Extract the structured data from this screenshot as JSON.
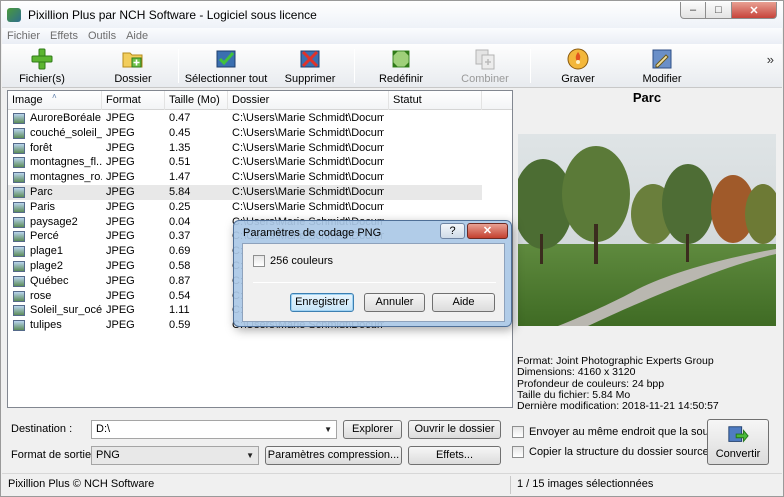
{
  "window": {
    "title": "Pixillion Plus par NCH Software - Logiciel sous licence",
    "minimize": "–",
    "maximize": "□",
    "close": "✕"
  },
  "menu": [
    "Fichier",
    "Effets",
    "Outils",
    "Aide"
  ],
  "toolbar": {
    "add_files": "Fichier(s)",
    "add_folder": "Dossier",
    "select_all": "Sélectionner tout",
    "remove": "Supprimer",
    "resize": "Redéfinir",
    "combine": "Combiner",
    "burn": "Graver",
    "edit": "Modifier",
    "more": "»"
  },
  "file_list": {
    "columns": [
      "Image",
      "Format",
      "Taille (Mo)",
      "Dossier",
      "Statut"
    ],
    "sort_indicator": "˄",
    "rows": [
      {
        "name": "AuroreBoréale",
        "format": "JPEG",
        "size": "0.47",
        "folder": "C:\\Users\\Marie Schmidt\\Docume...",
        "status": ""
      },
      {
        "name": "couché_soleil_...",
        "format": "JPEG",
        "size": "0.45",
        "folder": "C:\\Users\\Marie Schmidt\\Docume...",
        "status": ""
      },
      {
        "name": "forêt",
        "format": "JPEG",
        "size": "1.35",
        "folder": "C:\\Users\\Marie Schmidt\\Docume...",
        "status": ""
      },
      {
        "name": "montagnes_fl...",
        "format": "JPEG",
        "size": "0.51",
        "folder": "C:\\Users\\Marie Schmidt\\Docume...",
        "status": ""
      },
      {
        "name": "montagnes_ro...",
        "format": "JPEG",
        "size": "1.47",
        "folder": "C:\\Users\\Marie Schmidt\\Docume...",
        "status": ""
      },
      {
        "name": "Parc",
        "format": "JPEG",
        "size": "5.84",
        "folder": "C:\\Users\\Marie Schmidt\\Docume...",
        "status": ""
      },
      {
        "name": "Paris",
        "format": "JPEG",
        "size": "0.25",
        "folder": "C:\\Users\\Marie Schmidt\\Docume...",
        "status": ""
      },
      {
        "name": "paysage2",
        "format": "JPEG",
        "size": "0.04",
        "folder": "C:\\Users\\Marie Schmidt\\Docume...",
        "status": ""
      },
      {
        "name": "Percé",
        "format": "JPEG",
        "size": "0.37",
        "folder": "C:\\Users\\Marie Schmidt\\Docume...",
        "status": ""
      },
      {
        "name": "plage1",
        "format": "JPEG",
        "size": "0.69",
        "folder": "C:\\Users\\Marie Schmidt\\Docume...",
        "status": ""
      },
      {
        "name": "plage2",
        "format": "JPEG",
        "size": "0.58",
        "folder": "C:\\Users\\Marie Schmidt\\Docume...",
        "status": ""
      },
      {
        "name": "Québec",
        "format": "JPEG",
        "size": "0.87",
        "folder": "C:\\Users\\Marie Schmidt\\Docume...",
        "status": ""
      },
      {
        "name": "rose",
        "format": "JPEG",
        "size": "0.54",
        "folder": "C:\\Users\\Marie Schmidt\\Docume...",
        "status": ""
      },
      {
        "name": "Soleil_sur_océan",
        "format": "JPEG",
        "size": "1.11",
        "folder": "C:\\Users\\Marie Schmidt\\Docume...",
        "status": ""
      },
      {
        "name": "tulipes",
        "format": "JPEG",
        "size": "0.59",
        "folder": "C:\\Users\\Marie Schmidt\\Docume...",
        "status": ""
      }
    ],
    "selected_index": 5
  },
  "preview": {
    "title": "Parc",
    "info": [
      "Format: Joint Photographic Experts Group",
      "Dimensions: 4160 x 3120",
      "Profondeur de couleurs: 24 bpp",
      "Taille du fichier: 5.84 Mo",
      "Dernière modification: 2018-11-21 14:50:57"
    ]
  },
  "output": {
    "destination_label": "Destination :",
    "destination_value": "D:\\",
    "browse": "Explorer",
    "open_folder": "Ouvrir le dossier",
    "format_label": "Format de sortie :",
    "format_value": "PNG",
    "compression": "Paramètres compression...",
    "effects": "Effets...",
    "same_location": "Envoyer au même endroit que la source",
    "copy_structure": "Copier la structure du dossier source",
    "convert": "Convertir"
  },
  "status": {
    "left": "Pixillion Plus © NCH Software",
    "right": "1 / 15 images sélectionnées"
  },
  "dialog": {
    "title": "Paramètres de codage PNG",
    "help": "?",
    "close": "✕",
    "checkbox_256": "256 couleurs",
    "save": "Enregistrer",
    "cancel": "Annuler",
    "help_button": "Aide"
  }
}
